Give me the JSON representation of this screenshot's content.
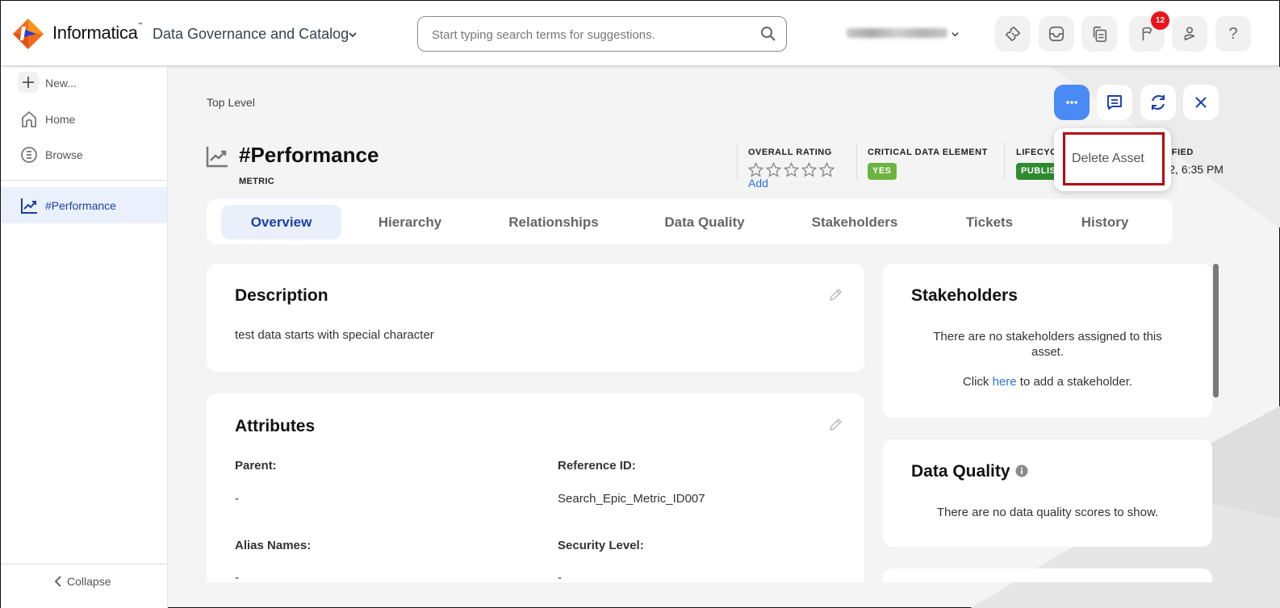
{
  "header": {
    "brand": "Informatica",
    "product": "Data Governance and Catalog",
    "search_placeholder": "Start typing search terms for suggestions.",
    "user_name_blurred": true,
    "notification_count": "12",
    "icons": [
      "ticket-icon",
      "inbox-icon",
      "copy-document-icon",
      "flag-icon",
      "user-icon",
      "help-icon"
    ]
  },
  "sidebar": {
    "new_label": "New...",
    "items": [
      {
        "label": "Home",
        "icon": "home-icon"
      },
      {
        "label": "Browse",
        "icon": "browse-icon"
      }
    ],
    "open_asset": {
      "label": "#Performance",
      "icon": "metric-icon"
    },
    "collapse_label": "Collapse"
  },
  "asset": {
    "breadcrumb": "Top Level",
    "title": "#Performance",
    "type": "METRIC",
    "meta": {
      "rating_label": "OVERALL RATING",
      "rating_value": 0,
      "rating_max": 5,
      "rating_add": "Add",
      "cde_label": "CRITICAL DATA ELEMENT",
      "cde_value": "YES",
      "lifecycle_label": "LIFECYCLE",
      "lifecycle_value": "PUBLISHED",
      "modified_label": "MODIFIED",
      "modified_value_visible": "2, 6:35 PM"
    },
    "actions": [
      "more-actions",
      "comments",
      "refresh",
      "close"
    ],
    "dropdown": {
      "items": [
        "Delete Asset"
      ]
    }
  },
  "tabs": [
    {
      "label": "Overview",
      "active": true
    },
    {
      "label": "Hierarchy",
      "active": false
    },
    {
      "label": "Relationships",
      "active": false
    },
    {
      "label": "Data Quality",
      "active": false
    },
    {
      "label": "Stakeholders",
      "active": false
    },
    {
      "label": "Tickets",
      "active": false
    },
    {
      "label": "History",
      "active": false
    }
  ],
  "description": {
    "title": "Description",
    "text": "test data starts with special character"
  },
  "attributes": {
    "title": "Attributes",
    "fields": [
      {
        "label": "Parent:",
        "value": "-"
      },
      {
        "label": "Reference ID:",
        "value": "Search_Epic_Metric_ID007"
      },
      {
        "label": "Alias Names:",
        "value": "-"
      },
      {
        "label": "Security Level:",
        "value": "-"
      }
    ]
  },
  "stakeholders": {
    "title": "Stakeholders",
    "empty_line1": "There are no stakeholders assigned to this asset.",
    "click_prefix": "Click ",
    "click_link": "here",
    "click_suffix": " to add a stakeholder."
  },
  "data_quality": {
    "title": "Data Quality",
    "empty_text": "There are no data quality scores to show."
  },
  "colors": {
    "primary_blue": "#4a8af4",
    "active_tab_text": "#1a3fa8",
    "active_tab_bg": "#e9f0fc",
    "cde_yes": "#6db33f",
    "lifecycle_published": "#2e8b2e",
    "badge_red": "#e8141b",
    "dropdown_highlight": "#b4060f",
    "link_blue": "#2f6fdb"
  }
}
